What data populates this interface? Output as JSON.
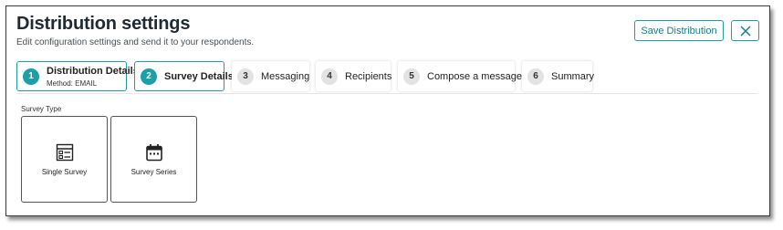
{
  "header": {
    "title": "Distribution settings",
    "subtitle": "Edit configuration settings and send it to your respondents.",
    "save_label": "Save Distribution",
    "close_icon": "close-icon"
  },
  "steps": [
    {
      "number": "1",
      "label": "Distribution Details",
      "sub": "Method: EMAIL",
      "state": "completed"
    },
    {
      "number": "2",
      "label": "Survey Details",
      "state": "active"
    },
    {
      "number": "3",
      "label": "Messaging"
    },
    {
      "number": "4",
      "label": "Recipients"
    },
    {
      "number": "5",
      "label": "Compose a message"
    },
    {
      "number": "6",
      "label": "Summary"
    }
  ],
  "survey_type": {
    "label": "Survey Type",
    "options": [
      {
        "label": "Single Survey",
        "icon": "list-icon"
      },
      {
        "label": "Survey Series",
        "icon": "calendar-icon"
      }
    ]
  },
  "colors": {
    "accent": "#1aa0a6",
    "inactive_step_number_bg": "#e3e3e3"
  }
}
